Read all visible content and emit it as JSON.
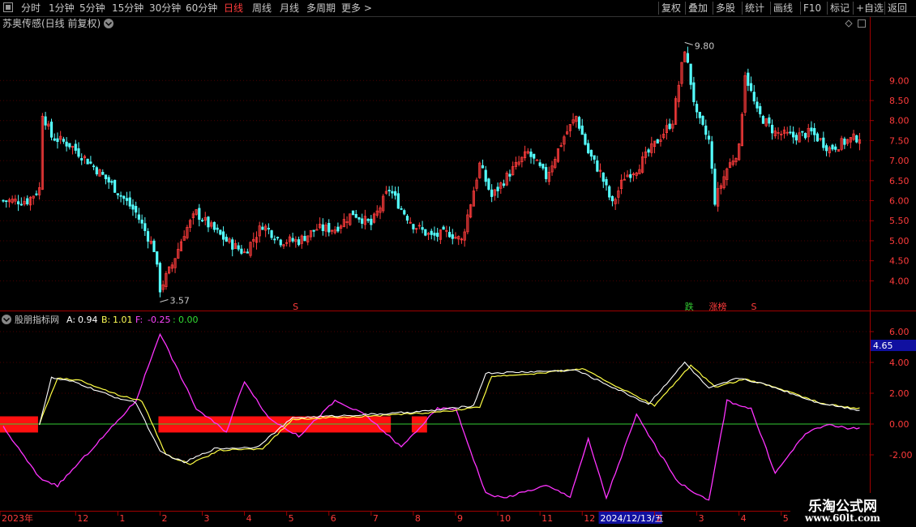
{
  "toolbar": {
    "items": [
      {
        "label": "分时",
        "active": false
      },
      {
        "label": "1分钟",
        "active": false
      },
      {
        "label": "5分钟",
        "active": false
      },
      {
        "label": "15分钟",
        "active": false
      },
      {
        "label": "30分钟",
        "active": false
      },
      {
        "label": "60分钟",
        "active": false
      },
      {
        "label": "日线",
        "active": true
      },
      {
        "label": "周线",
        "active": false
      },
      {
        "label": "月线",
        "active": false
      },
      {
        "label": "多周期",
        "active": false
      },
      {
        "label": "更多 >",
        "active": false
      }
    ],
    "right_items": [
      "复权",
      "叠加",
      "多股",
      "统计",
      "画线",
      "F10",
      "标记",
      "+自选",
      "返回"
    ]
  },
  "main_chart": {
    "title": "苏奥传感(日线 前复权)",
    "price_ticks": [
      "9.00",
      "8.50",
      "8.00",
      "7.50",
      "7.00",
      "6.50",
      "6.00",
      "5.50",
      "5.00",
      "4.50",
      "4.00"
    ],
    "high_label": "9.80",
    "low_label": "3.57",
    "markers": [
      {
        "text": "S",
        "color": "#ff3b3b",
        "x_index": 96
      },
      {
        "text": "跌",
        "color": "#33cc33",
        "x_index": 226
      },
      {
        "text": "涨榜",
        "color": "#ff3b3b",
        "x_index": 234
      },
      {
        "text": "S",
        "color": "#ff3b3b",
        "x_index": 248
      }
    ]
  },
  "indicator": {
    "title": "股朋指标网",
    "a_label": "A:",
    "a_value": "0.94",
    "b_label": "B:",
    "b_value": "1.01",
    "f_label": "F:",
    "f_value": "-0.25",
    "colon": ":",
    "zero_value": "0.00",
    "y_ticks": [
      "6.00",
      "4.00",
      "2.00",
      "0.00",
      "-2.00"
    ],
    "crosshair_value": "4.65"
  },
  "time_axis": {
    "labels": [
      "2023年",
      "12",
      "1",
      "2",
      "3",
      "4",
      "5",
      "6",
      "7",
      "8",
      "9",
      "10",
      "11",
      "12",
      "2024/12/13/五",
      "2",
      "3",
      "4",
      "5"
    ]
  },
  "watermark": {
    "line1": "乐淘公式网",
    "line2": "www.60lt.com"
  },
  "chart_data": {
    "type": "candlestick",
    "title": "苏奥传感(日线 前复权)",
    "ylim": [
      3.4,
      10.2
    ],
    "close_path": [
      [
        0,
        6.0
      ],
      [
        8,
        6.0
      ],
      [
        12,
        6.3
      ],
      [
        13,
        8.2
      ],
      [
        16,
        7.6
      ],
      [
        22,
        7.4
      ],
      [
        28,
        7.0
      ],
      [
        36,
        6.4
      ],
      [
        44,
        5.7
      ],
      [
        50,
        4.8
      ],
      [
        52,
        3.8
      ],
      [
        56,
        4.4
      ],
      [
        60,
        5.2
      ],
      [
        64,
        5.7
      ],
      [
        68,
        5.4
      ],
      [
        74,
        5.0
      ],
      [
        80,
        4.7
      ],
      [
        86,
        5.4
      ],
      [
        92,
        5.0
      ],
      [
        98,
        5.0
      ],
      [
        104,
        5.3
      ],
      [
        110,
        5.3
      ],
      [
        116,
        5.7
      ],
      [
        122,
        5.4
      ],
      [
        128,
        6.3
      ],
      [
        132,
        5.8
      ],
      [
        136,
        5.4
      ],
      [
        142,
        5.1
      ],
      [
        148,
        5.2
      ],
      [
        152,
        5.0
      ],
      [
        158,
        6.9
      ],
      [
        162,
        6.1
      ],
      [
        168,
        6.7
      ],
      [
        174,
        7.2
      ],
      [
        180,
        6.6
      ],
      [
        186,
        7.6
      ],
      [
        190,
        8.1
      ],
      [
        194,
        7.2
      ],
      [
        198,
        6.7
      ],
      [
        202,
        5.9
      ],
      [
        206,
        6.6
      ],
      [
        210,
        6.8
      ],
      [
        216,
        7.4
      ],
      [
        222,
        8.0
      ],
      [
        226,
        9.8
      ],
      [
        230,
        8.1
      ],
      [
        234,
        7.5
      ],
      [
        236,
        6.0
      ],
      [
        240,
        6.8
      ],
      [
        244,
        7.3
      ],
      [
        246,
        9.2
      ],
      [
        250,
        8.2
      ],
      [
        256,
        7.7
      ],
      [
        262,
        7.6
      ],
      [
        268,
        7.7
      ],
      [
        274,
        7.3
      ],
      [
        280,
        7.5
      ],
      [
        284,
        7.6
      ]
    ],
    "indicator_series": {
      "A_path": [
        [
          12,
          0.0
        ],
        [
          16,
          3.0
        ],
        [
          24,
          2.7
        ],
        [
          36,
          1.8
        ],
        [
          44,
          1.4
        ],
        [
          52,
          -1.8
        ],
        [
          60,
          -2.5
        ],
        [
          70,
          -1.6
        ],
        [
          84,
          -1.5
        ],
        [
          96,
          0.4
        ],
        [
          130,
          0.7
        ],
        [
          144,
          0.9
        ],
        [
          156,
          1.2
        ],
        [
          160,
          3.3
        ],
        [
          176,
          3.4
        ],
        [
          190,
          3.5
        ],
        [
          214,
          1.3
        ],
        [
          226,
          4.0
        ],
        [
          234,
          2.3
        ],
        [
          244,
          3.0
        ],
        [
          254,
          2.5
        ],
        [
          270,
          1.4
        ],
        [
          284,
          0.9
        ]
      ],
      "B_path": [
        [
          12,
          0.0
        ],
        [
          18,
          3.0
        ],
        [
          26,
          2.8
        ],
        [
          38,
          1.9
        ],
        [
          46,
          1.5
        ],
        [
          54,
          -2.0
        ],
        [
          62,
          -2.6
        ],
        [
          72,
          -1.7
        ],
        [
          86,
          -1.6
        ],
        [
          96,
          0.3
        ],
        [
          130,
          0.6
        ],
        [
          146,
          0.8
        ],
        [
          158,
          1.1
        ],
        [
          162,
          3.1
        ],
        [
          178,
          3.3
        ],
        [
          192,
          3.6
        ],
        [
          216,
          1.2
        ],
        [
          228,
          3.8
        ],
        [
          236,
          2.4
        ],
        [
          246,
          2.9
        ],
        [
          256,
          2.4
        ],
        [
          272,
          1.3
        ],
        [
          284,
          1.0
        ]
      ],
      "F_path": [
        [
          0,
          -0.2
        ],
        [
          12,
          -3.5
        ],
        [
          18,
          -4.0
        ],
        [
          30,
          -1.5
        ],
        [
          44,
          1.5
        ],
        [
          52,
          5.9
        ],
        [
          64,
          1.0
        ],
        [
          74,
          -0.5
        ],
        [
          80,
          2.8
        ],
        [
          88,
          0.4
        ],
        [
          98,
          -0.8
        ],
        [
          110,
          1.5
        ],
        [
          120,
          0.6
        ],
        [
          132,
          -1.5
        ],
        [
          144,
          1.0
        ],
        [
          150,
          1.0
        ],
        [
          160,
          -4.5
        ],
        [
          166,
          -4.8
        ],
        [
          180,
          -4.0
        ],
        [
          188,
          -4.7
        ],
        [
          194,
          -1.0
        ],
        [
          200,
          -4.8
        ],
        [
          210,
          0.6
        ],
        [
          218,
          -2.0
        ],
        [
          224,
          -3.8
        ],
        [
          234,
          -5.0
        ],
        [
          240,
          1.5
        ],
        [
          248,
          1.0
        ],
        [
          256,
          -3.2
        ],
        [
          266,
          -0.6
        ],
        [
          274,
          0.0
        ],
        [
          280,
          -0.3
        ],
        [
          284,
          -0.25
        ]
      ],
      "red_bar_ranges": [
        [
          0,
          11
        ],
        [
          52,
          128
        ],
        [
          136,
          140
        ]
      ]
    }
  }
}
